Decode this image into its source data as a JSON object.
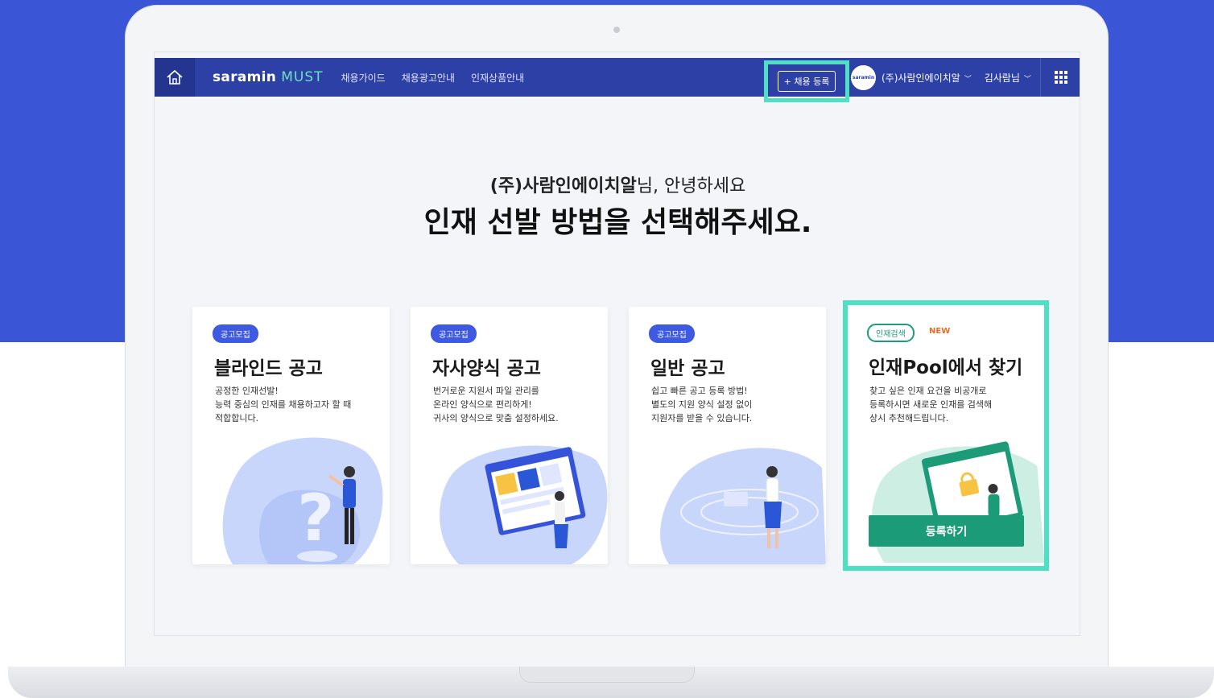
{
  "nav": {
    "logo": "saramin",
    "logo_sub": "MUST",
    "menu": [
      "채용가이드",
      "채용광고안내",
      "인재상품안내"
    ],
    "register_label": "+ 채용 등록",
    "avatar_text": "saramin",
    "company": "(주)사람인에이치알",
    "user": "김사람님"
  },
  "hero": {
    "company": "(주)사람인에이치알",
    "greeting_suffix": "님, 안녕하세요",
    "headline": "인재 선발 방법을 선택해주세요."
  },
  "cards": [
    {
      "badge": "공고모집",
      "title": "블라인드 공고",
      "desc": [
        "공정한 인재선발!",
        "능력 중심의 인재를 채용하고자 할 때",
        "적합합니다."
      ]
    },
    {
      "badge": "공고모집",
      "title": "자사양식 공고",
      "desc": [
        "번거로운 지원서 파일 관리를",
        "온라인 양식으로 편리하게!",
        "귀사의 양식으로 맞춤 설정하세요."
      ]
    },
    {
      "badge": "공고모집",
      "title": "일반 공고",
      "desc": [
        "쉽고 빠른 공고 등록 방법!",
        "별도의 지원 양식 설정 없이",
        "지원자를 받을 수 있습니다."
      ]
    },
    {
      "badge": "인재검색",
      "new_label": "NEW",
      "title": "인재Pool에서 찾기",
      "desc": [
        "찾고 싶은 인재 요건을 비공개로",
        "등록하시면 새로운 인재를 검색해",
        "상시 추천해드립니다."
      ],
      "button": "등록하기"
    }
  ],
  "colors": {
    "background_blue": "#3a55d6",
    "nav": "#2c40a6",
    "highlight": "#4de0c2",
    "badge": "#3d5ae0",
    "green_button": "#1c9b79",
    "new": "#f06a22"
  }
}
